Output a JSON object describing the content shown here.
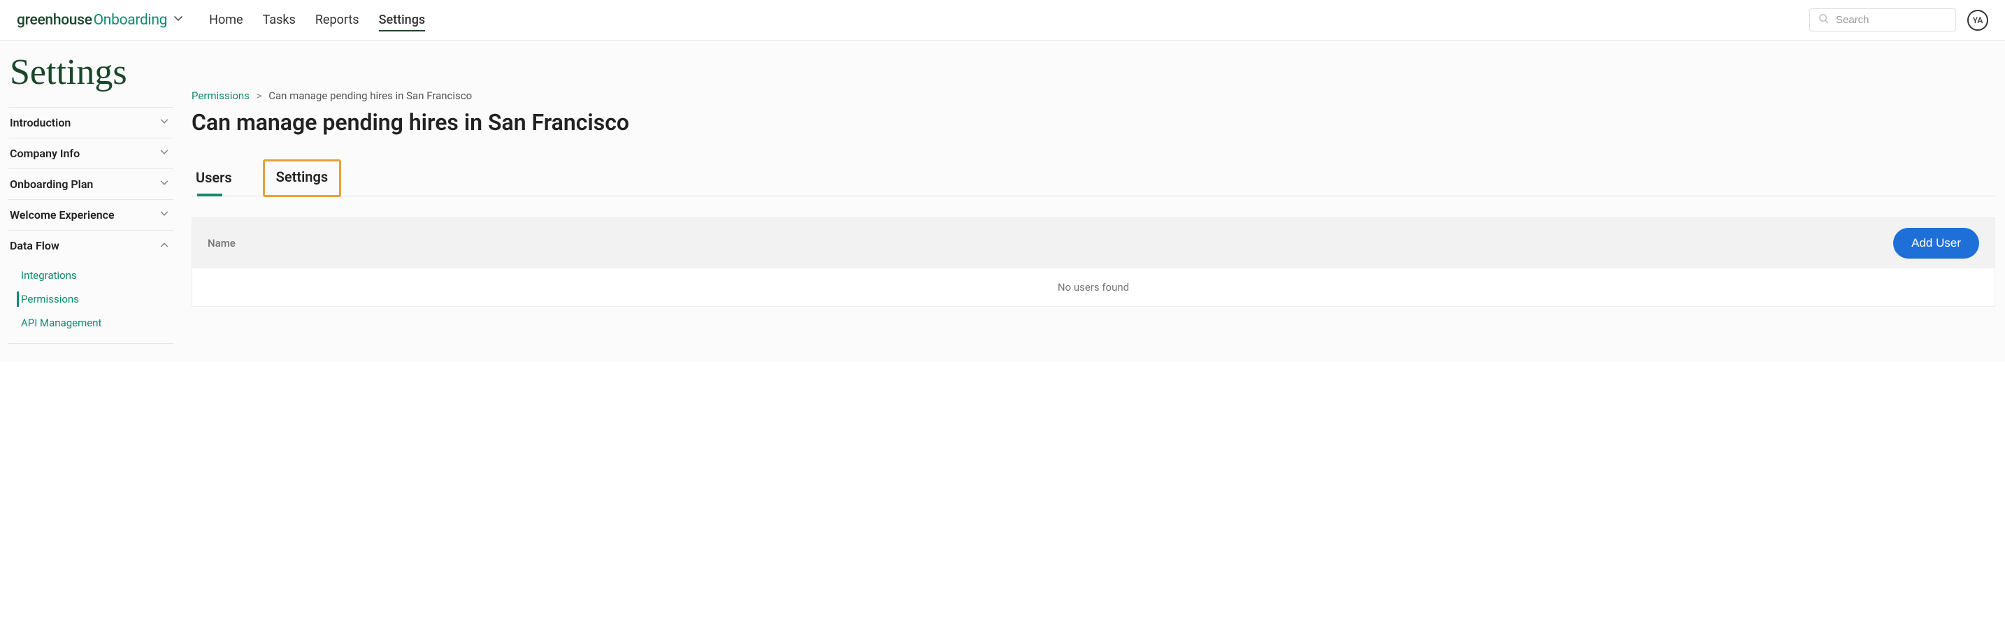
{
  "logo": {
    "brand": "greenhouse",
    "product": "Onboarding"
  },
  "nav": {
    "home": "Home",
    "tasks": "Tasks",
    "reports": "Reports",
    "settings": "Settings"
  },
  "search": {
    "placeholder": "Search"
  },
  "avatar": {
    "initials": "YA"
  },
  "page": {
    "title": "Settings"
  },
  "sidebar": {
    "introduction": "Introduction",
    "company_info": "Company Info",
    "onboarding_plan": "Onboarding Plan",
    "welcome_experience": "Welcome Experience",
    "data_flow": "Data Flow",
    "data_flow_items": {
      "integrations": "Integrations",
      "permissions": "Permissions",
      "api_management": "API Management"
    }
  },
  "breadcrumb": {
    "root": "Permissions",
    "current": "Can manage pending hires in San Francisco"
  },
  "content": {
    "title": "Can manage pending hires in San Francisco",
    "tabs": {
      "users": "Users",
      "settings": "Settings"
    },
    "table": {
      "col_name": "Name",
      "add_user": "Add User",
      "empty": "No users found"
    }
  }
}
